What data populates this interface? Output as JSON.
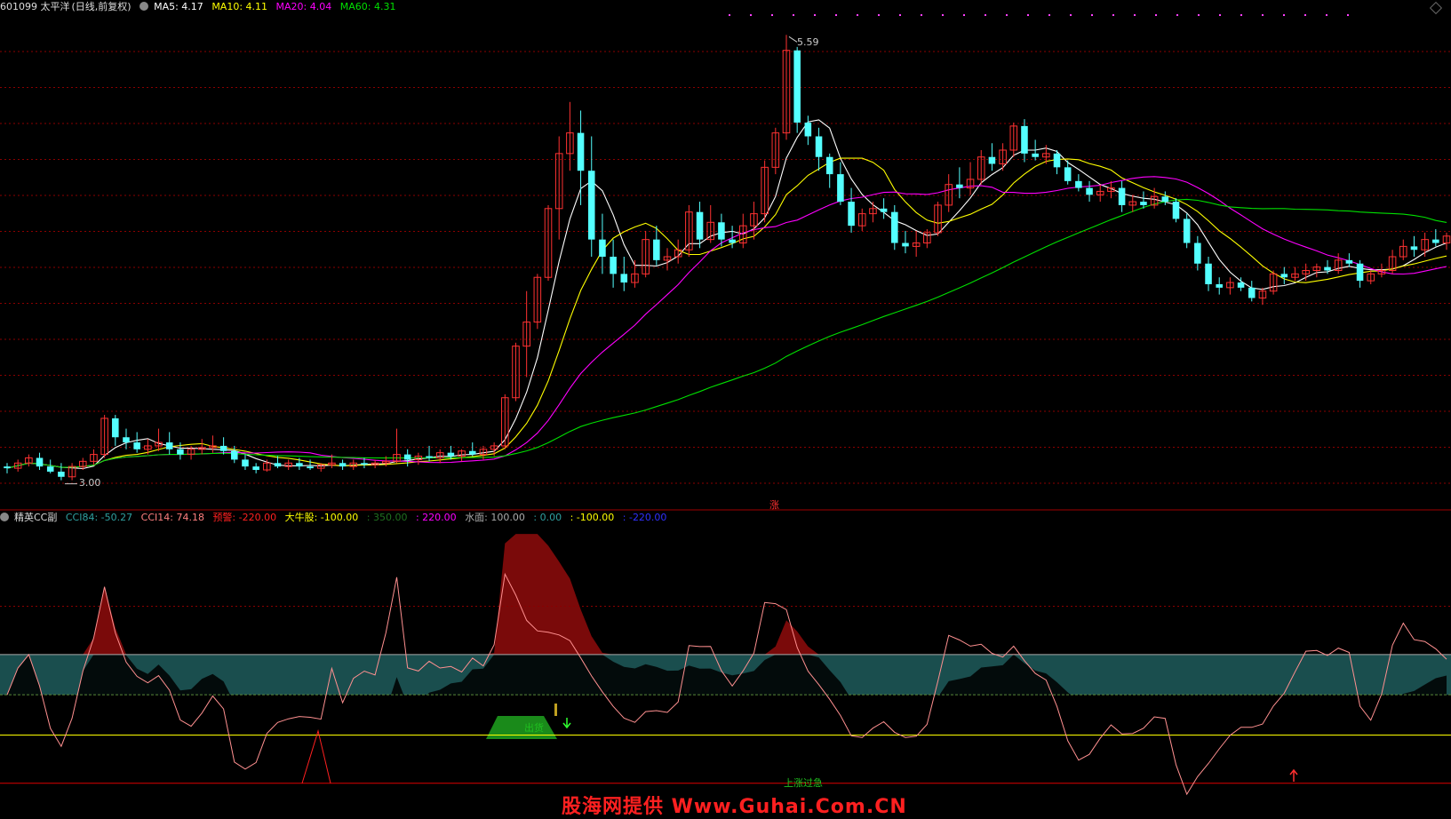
{
  "header": {
    "security": "601099 太平洋",
    "period": "(日线,前复权)",
    "ma5_label": "MA5: 4.17",
    "ma10_label": "MA10: 4.11",
    "ma20_label": "MA20: 4.04",
    "ma60_label": "MA60: 4.31"
  },
  "indicator_header": {
    "name": "精英CC副",
    "cci84": "CCI84: -50.27",
    "cci14": "CCI14: 74.18",
    "alarm": "预警: -220.00",
    "bull": "大牛股: -100.00",
    "v350": ": 350.00",
    "v220": ": 220.00",
    "water": "水面: 100.00",
    "v0": ": 0.00",
    "vneg100": ": -100.00",
    "vneg220": ": -220.00"
  },
  "labels": {
    "high": "5.59",
    "low": "3.00",
    "zhang": "涨",
    "chuhuo": "出货",
    "overheat": "上涨过急",
    "watermark": "股海网提供 Www.Guhai.Com.CN"
  },
  "colors": {
    "up": "#ff3232",
    "down": "#54ffff",
    "ma5": "#ffffff",
    "ma10": "#ffff00",
    "ma20": "#ff00ff",
    "ma60": "#00e000",
    "grid": "#8b0000"
  },
  "chart_data": [
    {
      "type": "candlestick",
      "ylim": [
        2.9,
        5.7
      ],
      "high_label": 5.59,
      "low_label": 3.0,
      "ohlc": [
        [
          3.08,
          3.1,
          3.04,
          3.07
        ],
        [
          3.07,
          3.12,
          3.05,
          3.1
        ],
        [
          3.1,
          3.15,
          3.08,
          3.13
        ],
        [
          3.13,
          3.16,
          3.06,
          3.08
        ],
        [
          3.08,
          3.12,
          3.04,
          3.05
        ],
        [
          3.05,
          3.1,
          3.0,
          3.02
        ],
        [
          3.02,
          3.1,
          3.0,
          3.08
        ],
        [
          3.08,
          3.13,
          3.06,
          3.11
        ],
        [
          3.11,
          3.18,
          3.09,
          3.15
        ],
        [
          3.15,
          3.38,
          3.13,
          3.36
        ],
        [
          3.36,
          3.38,
          3.2,
          3.25
        ],
        [
          3.25,
          3.3,
          3.18,
          3.22
        ],
        [
          3.22,
          3.28,
          3.16,
          3.18
        ],
        [
          3.18,
          3.24,
          3.15,
          3.2
        ],
        [
          3.2,
          3.3,
          3.17,
          3.22
        ],
        [
          3.22,
          3.28,
          3.15,
          3.18
        ],
        [
          3.18,
          3.22,
          3.12,
          3.15
        ],
        [
          3.15,
          3.2,
          3.12,
          3.18
        ],
        [
          3.18,
          3.24,
          3.15,
          3.19
        ],
        [
          3.19,
          3.26,
          3.16,
          3.2
        ],
        [
          3.2,
          3.25,
          3.15,
          3.17
        ],
        [
          3.17,
          3.2,
          3.1,
          3.12
        ],
        [
          3.12,
          3.15,
          3.06,
          3.08
        ],
        [
          3.08,
          3.1,
          3.04,
          3.06
        ],
        [
          3.06,
          3.12,
          3.05,
          3.1
        ],
        [
          3.1,
          3.14,
          3.07,
          3.08
        ],
        [
          3.08,
          3.12,
          3.06,
          3.1
        ],
        [
          3.1,
          3.13,
          3.06,
          3.08
        ],
        [
          3.08,
          3.12,
          3.06,
          3.07
        ],
        [
          3.07,
          3.1,
          3.05,
          3.09
        ],
        [
          3.09,
          3.15,
          3.07,
          3.1
        ],
        [
          3.1,
          3.12,
          3.06,
          3.08
        ],
        [
          3.08,
          3.12,
          3.06,
          3.1
        ],
        [
          3.1,
          3.13,
          3.07,
          3.09
        ],
        [
          3.09,
          3.12,
          3.07,
          3.1
        ],
        [
          3.1,
          3.14,
          3.08,
          3.11
        ],
        [
          3.11,
          3.3,
          3.1,
          3.15
        ],
        [
          3.15,
          3.18,
          3.08,
          3.12
        ],
        [
          3.12,
          3.16,
          3.09,
          3.14
        ],
        [
          3.14,
          3.2,
          3.11,
          3.13
        ],
        [
          3.13,
          3.18,
          3.1,
          3.16
        ],
        [
          3.16,
          3.2,
          3.12,
          3.14
        ],
        [
          3.14,
          3.18,
          3.11,
          3.17
        ],
        [
          3.17,
          3.22,
          3.14,
          3.15
        ],
        [
          3.15,
          3.2,
          3.12,
          3.18
        ],
        [
          3.18,
          3.22,
          3.14,
          3.2
        ],
        [
          3.2,
          3.5,
          3.18,
          3.48
        ],
        [
          3.48,
          3.8,
          3.46,
          3.78
        ],
        [
          3.78,
          4.1,
          3.6,
          3.92
        ],
        [
          3.92,
          4.2,
          3.88,
          4.18
        ],
        [
          4.18,
          4.6,
          4.16,
          4.58
        ],
        [
          4.58,
          5.0,
          4.4,
          4.9
        ],
        [
          4.9,
          5.2,
          4.8,
          5.02
        ],
        [
          5.02,
          5.15,
          4.6,
          4.8
        ],
        [
          4.8,
          5.0,
          4.3,
          4.4
        ],
        [
          4.4,
          4.55,
          4.2,
          4.3
        ],
        [
          4.3,
          4.4,
          4.12,
          4.2
        ],
        [
          4.2,
          4.3,
          4.1,
          4.15
        ],
        [
          4.15,
          4.28,
          4.12,
          4.2
        ],
        [
          4.2,
          4.45,
          4.18,
          4.4
        ],
        [
          4.4,
          4.48,
          4.25,
          4.28
        ],
        [
          4.28,
          4.35,
          4.22,
          4.3
        ],
        [
          4.3,
          4.4,
          4.26,
          4.34
        ],
        [
          4.34,
          4.6,
          4.3,
          4.56
        ],
        [
          4.56,
          4.62,
          4.35,
          4.4
        ],
        [
          4.4,
          4.6,
          4.38,
          4.5
        ],
        [
          4.5,
          4.55,
          4.36,
          4.4
        ],
        [
          4.4,
          4.48,
          4.35,
          4.38
        ],
        [
          4.38,
          4.55,
          4.35,
          4.48
        ],
        [
          4.48,
          4.62,
          4.4,
          4.55
        ],
        [
          4.55,
          4.86,
          4.5,
          4.82
        ],
        [
          4.82,
          5.05,
          4.78,
          5.02
        ],
        [
          5.02,
          5.59,
          4.98,
          5.5
        ],
        [
          5.5,
          5.52,
          5.02,
          5.08
        ],
        [
          5.08,
          5.12,
          4.95,
          5.0
        ],
        [
          5.0,
          5.05,
          4.8,
          4.88
        ],
        [
          4.88,
          4.9,
          4.7,
          4.78
        ],
        [
          4.78,
          4.85,
          4.6,
          4.62
        ],
        [
          4.62,
          4.7,
          4.44,
          4.48
        ],
        [
          4.48,
          4.58,
          4.45,
          4.55
        ],
        [
          4.55,
          4.62,
          4.5,
          4.58
        ],
        [
          4.58,
          4.64,
          4.52,
          4.56
        ],
        [
          4.56,
          4.6,
          4.34,
          4.38
        ],
        [
          4.38,
          4.45,
          4.32,
          4.36
        ],
        [
          4.36,
          4.45,
          4.3,
          4.38
        ],
        [
          4.38,
          4.46,
          4.35,
          4.44
        ],
        [
          4.44,
          4.62,
          4.42,
          4.6
        ],
        [
          4.6,
          4.78,
          4.56,
          4.72
        ],
        [
          4.72,
          4.82,
          4.64,
          4.7
        ],
        [
          4.7,
          4.85,
          4.66,
          4.75
        ],
        [
          4.75,
          4.92,
          4.72,
          4.88
        ],
        [
          4.88,
          4.96,
          4.8,
          4.84
        ],
        [
          4.84,
          4.96,
          4.8,
          4.92
        ],
        [
          4.92,
          5.08,
          4.88,
          5.06
        ],
        [
          5.06,
          5.1,
          4.85,
          4.9
        ],
        [
          4.9,
          4.98,
          4.86,
          4.88
        ],
        [
          4.88,
          4.95,
          4.84,
          4.9
        ],
        [
          4.9,
          4.92,
          4.78,
          4.82
        ],
        [
          4.82,
          4.86,
          4.72,
          4.74
        ],
        [
          4.74,
          4.78,
          4.68,
          4.7
        ],
        [
          4.7,
          4.74,
          4.62,
          4.66
        ],
        [
          4.66,
          4.72,
          4.62,
          4.68
        ],
        [
          4.68,
          4.74,
          4.64,
          4.7
        ],
        [
          4.7,
          4.74,
          4.56,
          4.6
        ],
        [
          4.6,
          4.66,
          4.56,
          4.62
        ],
        [
          4.62,
          4.68,
          4.58,
          4.6
        ],
        [
          4.6,
          4.7,
          4.58,
          4.65
        ],
        [
          4.65,
          4.68,
          4.6,
          4.62
        ],
        [
          4.62,
          4.64,
          4.5,
          4.52
        ],
        [
          4.52,
          4.55,
          4.35,
          4.38
        ],
        [
          4.38,
          4.42,
          4.22,
          4.26
        ],
        [
          4.26,
          4.3,
          4.1,
          4.14
        ],
        [
          4.14,
          4.18,
          4.08,
          4.12
        ],
        [
          4.12,
          4.18,
          4.08,
          4.15
        ],
        [
          4.15,
          4.18,
          4.1,
          4.12
        ],
        [
          4.12,
          4.16,
          4.04,
          4.06
        ],
        [
          4.06,
          4.12,
          4.02,
          4.1
        ],
        [
          4.1,
          4.22,
          4.08,
          4.2
        ],
        [
          4.2,
          4.24,
          4.14,
          4.18
        ],
        [
          4.18,
          4.24,
          4.16,
          4.2
        ],
        [
          4.2,
          4.26,
          4.16,
          4.22
        ],
        [
          4.22,
          4.26,
          4.18,
          4.24
        ],
        [
          4.24,
          4.28,
          4.2,
          4.22
        ],
        [
          4.22,
          4.32,
          4.2,
          4.28
        ],
        [
          4.28,
          4.32,
          4.24,
          4.26
        ],
        [
          4.26,
          4.28,
          4.12,
          4.16
        ],
        [
          4.16,
          4.22,
          4.14,
          4.2
        ],
        [
          4.2,
          4.26,
          4.18,
          4.22
        ],
        [
          4.22,
          4.34,
          4.2,
          4.3
        ],
        [
          4.3,
          4.4,
          4.28,
          4.36
        ],
        [
          4.36,
          4.42,
          4.3,
          4.34
        ],
        [
          4.34,
          4.44,
          4.3,
          4.4
        ],
        [
          4.4,
          4.46,
          4.36,
          4.38
        ],
        [
          4.38,
          4.44,
          4.34,
          4.42
        ]
      ]
    },
    {
      "type": "line",
      "name": "精英CC副",
      "ylim": [
        -300,
        420
      ],
      "reference_levels": [
        350,
        220,
        100,
        0,
        -100,
        -220
      ]
    }
  ]
}
